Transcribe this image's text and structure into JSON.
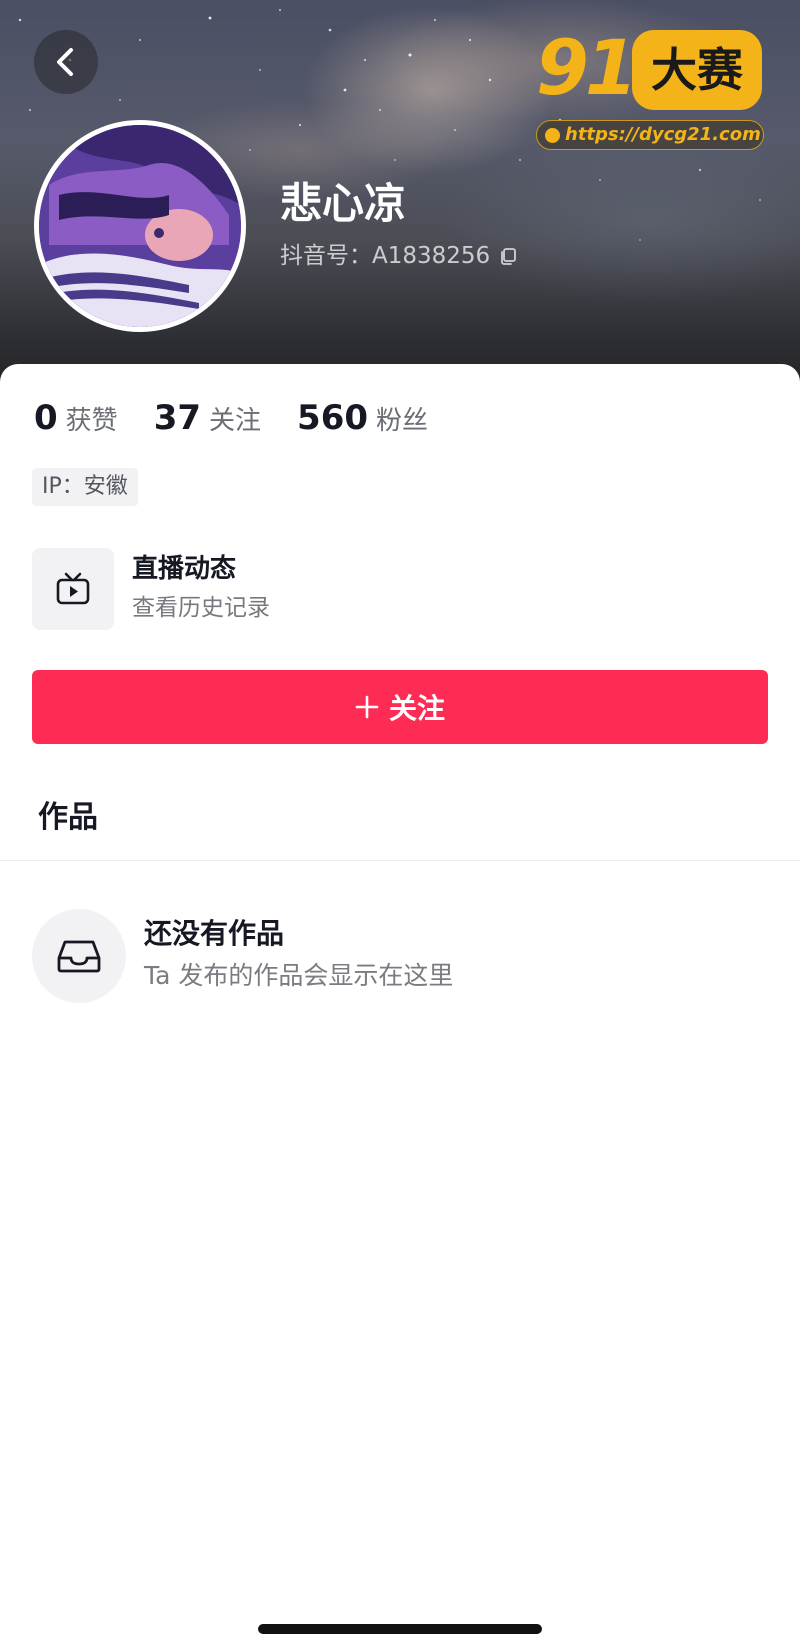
{
  "header": {
    "back_icon": "chevron-left-icon",
    "username": "悲心凉",
    "douyin_id": "抖音号：A1838256",
    "copy_icon": "copy-icon"
  },
  "watermark": {
    "number_text": "91",
    "badge_text": "大赛",
    "url": "https://dycg21.com",
    "color": "#f4b419"
  },
  "stats": [
    {
      "value": "0",
      "label": "获赞"
    },
    {
      "value": "37",
      "label": "关注"
    },
    {
      "value": "560",
      "label": "粉丝"
    }
  ],
  "ip_tag": "IP：安徽",
  "live": {
    "icon": "tv-play-icon",
    "title": "直播动态",
    "subtitle": "查看历史记录"
  },
  "follow_button": {
    "label": "关注",
    "icon": "plus-icon",
    "color": "#fe2c55"
  },
  "tabs": {
    "works": "作品"
  },
  "empty_state": {
    "icon": "inbox-tray-icon",
    "title": "还没有作品",
    "subtitle": "Ta 发布的作品会显示在这里"
  }
}
